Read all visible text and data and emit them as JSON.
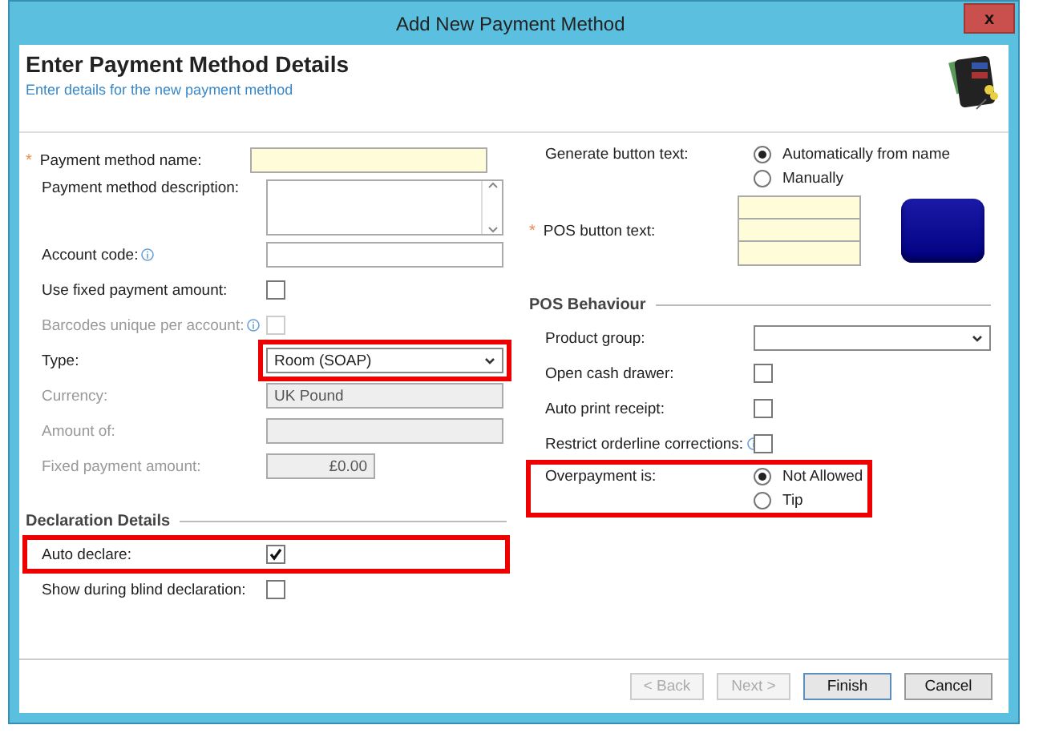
{
  "window": {
    "title": "Add New Payment Method",
    "close": "x"
  },
  "header": {
    "title": "Enter Payment Method Details",
    "subtitle": "Enter details for the new payment method"
  },
  "left_fields": [
    {
      "kind": "text",
      "label": "Payment method name:",
      "marker": "*",
      "disabled": false
    },
    {
      "kind": "textarea",
      "label": "Payment method description:",
      "disabled": false
    },
    {
      "kind": "text",
      "label": "Account code:",
      "info": true,
      "disabled": false
    },
    {
      "kind": "checkbox",
      "label": "Use fixed payment amount:",
      "disabled": false,
      "checked": false
    },
    {
      "kind": "checkbox",
      "label": "Barcodes unique per account:",
      "info": true,
      "disabled": true,
      "checked": false
    },
    {
      "kind": "select",
      "label": "Type:",
      "disabled": false,
      "value": "Room (SOAP)",
      "highlighted": true
    },
    {
      "kind": "text",
      "label": "Currency:",
      "disabled": true,
      "value": "UK Pound"
    },
    {
      "kind": "text",
      "label": "Amount of:",
      "disabled": true
    },
    {
      "kind": "amount",
      "label": "Fixed payment amount:",
      "disabled": true,
      "value": "£0.00"
    }
  ],
  "declaration": {
    "heading": "Declaration Details",
    "fields": [
      {
        "kind": "checkbox",
        "label": "Auto declare:",
        "disabled": false,
        "checked": true,
        "highlighted": true
      },
      {
        "kind": "checkbox",
        "label": "Show during blind declaration:",
        "disabled": false,
        "checked": false
      }
    ]
  },
  "generate": {
    "label": "Generate button text:",
    "options": [
      {
        "label": "Automatically from name",
        "selected": true
      },
      {
        "label": "Manually",
        "selected": false
      }
    ]
  },
  "pos_button_text": {
    "label": "POS button text:",
    "marker": "*"
  },
  "pos_behaviour": {
    "heading": "POS Behaviour",
    "fields": [
      {
        "kind": "select",
        "label": "Product group:",
        "disabled": false
      },
      {
        "kind": "checkbox",
        "label": "Open cash drawer:",
        "disabled": false,
        "checked": false
      },
      {
        "kind": "checkbox",
        "label": "Auto print receipt:",
        "disabled": false,
        "checked": false
      },
      {
        "kind": "checkbox",
        "label": "Restrict orderline corrections:",
        "info": true,
        "disabled": false,
        "checked": false
      }
    ]
  },
  "overpayment": {
    "label": "Overpayment is:",
    "highlighted": true,
    "options": [
      {
        "label": "Not Allowed",
        "selected": true
      },
      {
        "label": "Tip",
        "selected": false
      }
    ]
  },
  "buttons": [
    {
      "label": "< Back",
      "disabled": true,
      "default": false
    },
    {
      "label": "Next >",
      "disabled": true,
      "default": false
    },
    {
      "label": "Finish",
      "disabled": false,
      "default": true
    },
    {
      "label": "Cancel",
      "disabled": false,
      "default": false
    }
  ]
}
